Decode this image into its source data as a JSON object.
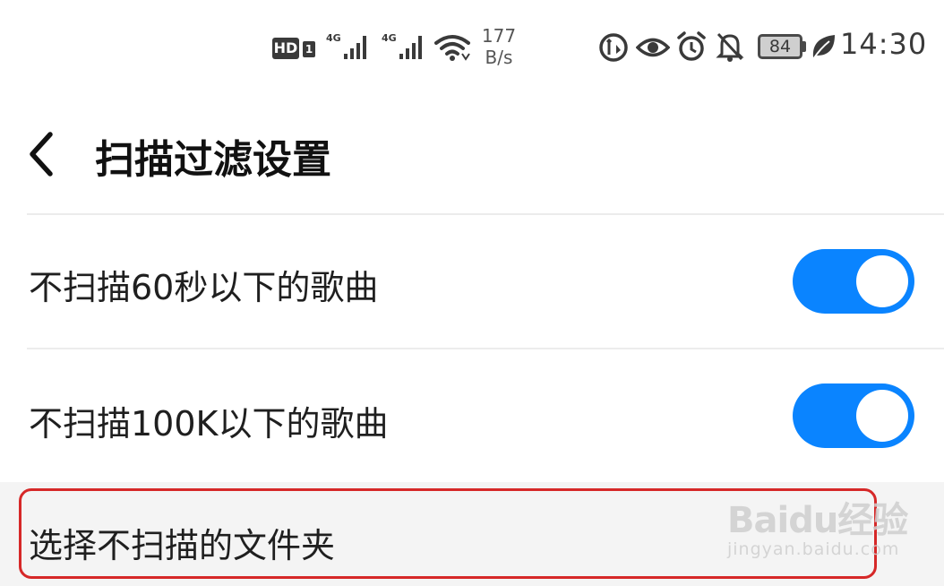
{
  "status_bar": {
    "hd_label": "HD",
    "hd_sim": "1",
    "sim1_network": "4G",
    "sim2_network": "4G",
    "speed_value": "177",
    "speed_unit": "B/s",
    "battery_level": "84",
    "time": "14:30",
    "icons": [
      "hd-icon",
      "signal-icon",
      "signal-icon",
      "wifi-icon",
      "data-saver-icon",
      "eye-comfort-icon",
      "alarm-icon",
      "bell-off-icon",
      "battery-icon",
      "leaf-icon"
    ]
  },
  "header": {
    "title": "扫描过滤设置",
    "back_icon": "chevron-left-icon"
  },
  "settings": [
    {
      "label": "不扫描60秒以下的歌曲",
      "enabled": true
    },
    {
      "label": "不扫描100K以下的歌曲",
      "enabled": true
    }
  ],
  "folder_option": {
    "label": "选择不扫描的文件夹"
  },
  "watermark": {
    "logo": "Baidu经验",
    "domain": "jingyan.baidu.com"
  },
  "colors": {
    "toggle_on": "#0a84ff",
    "highlight": "#d62828",
    "background": "#ffffff",
    "selected_row": "#f4f4f4"
  }
}
